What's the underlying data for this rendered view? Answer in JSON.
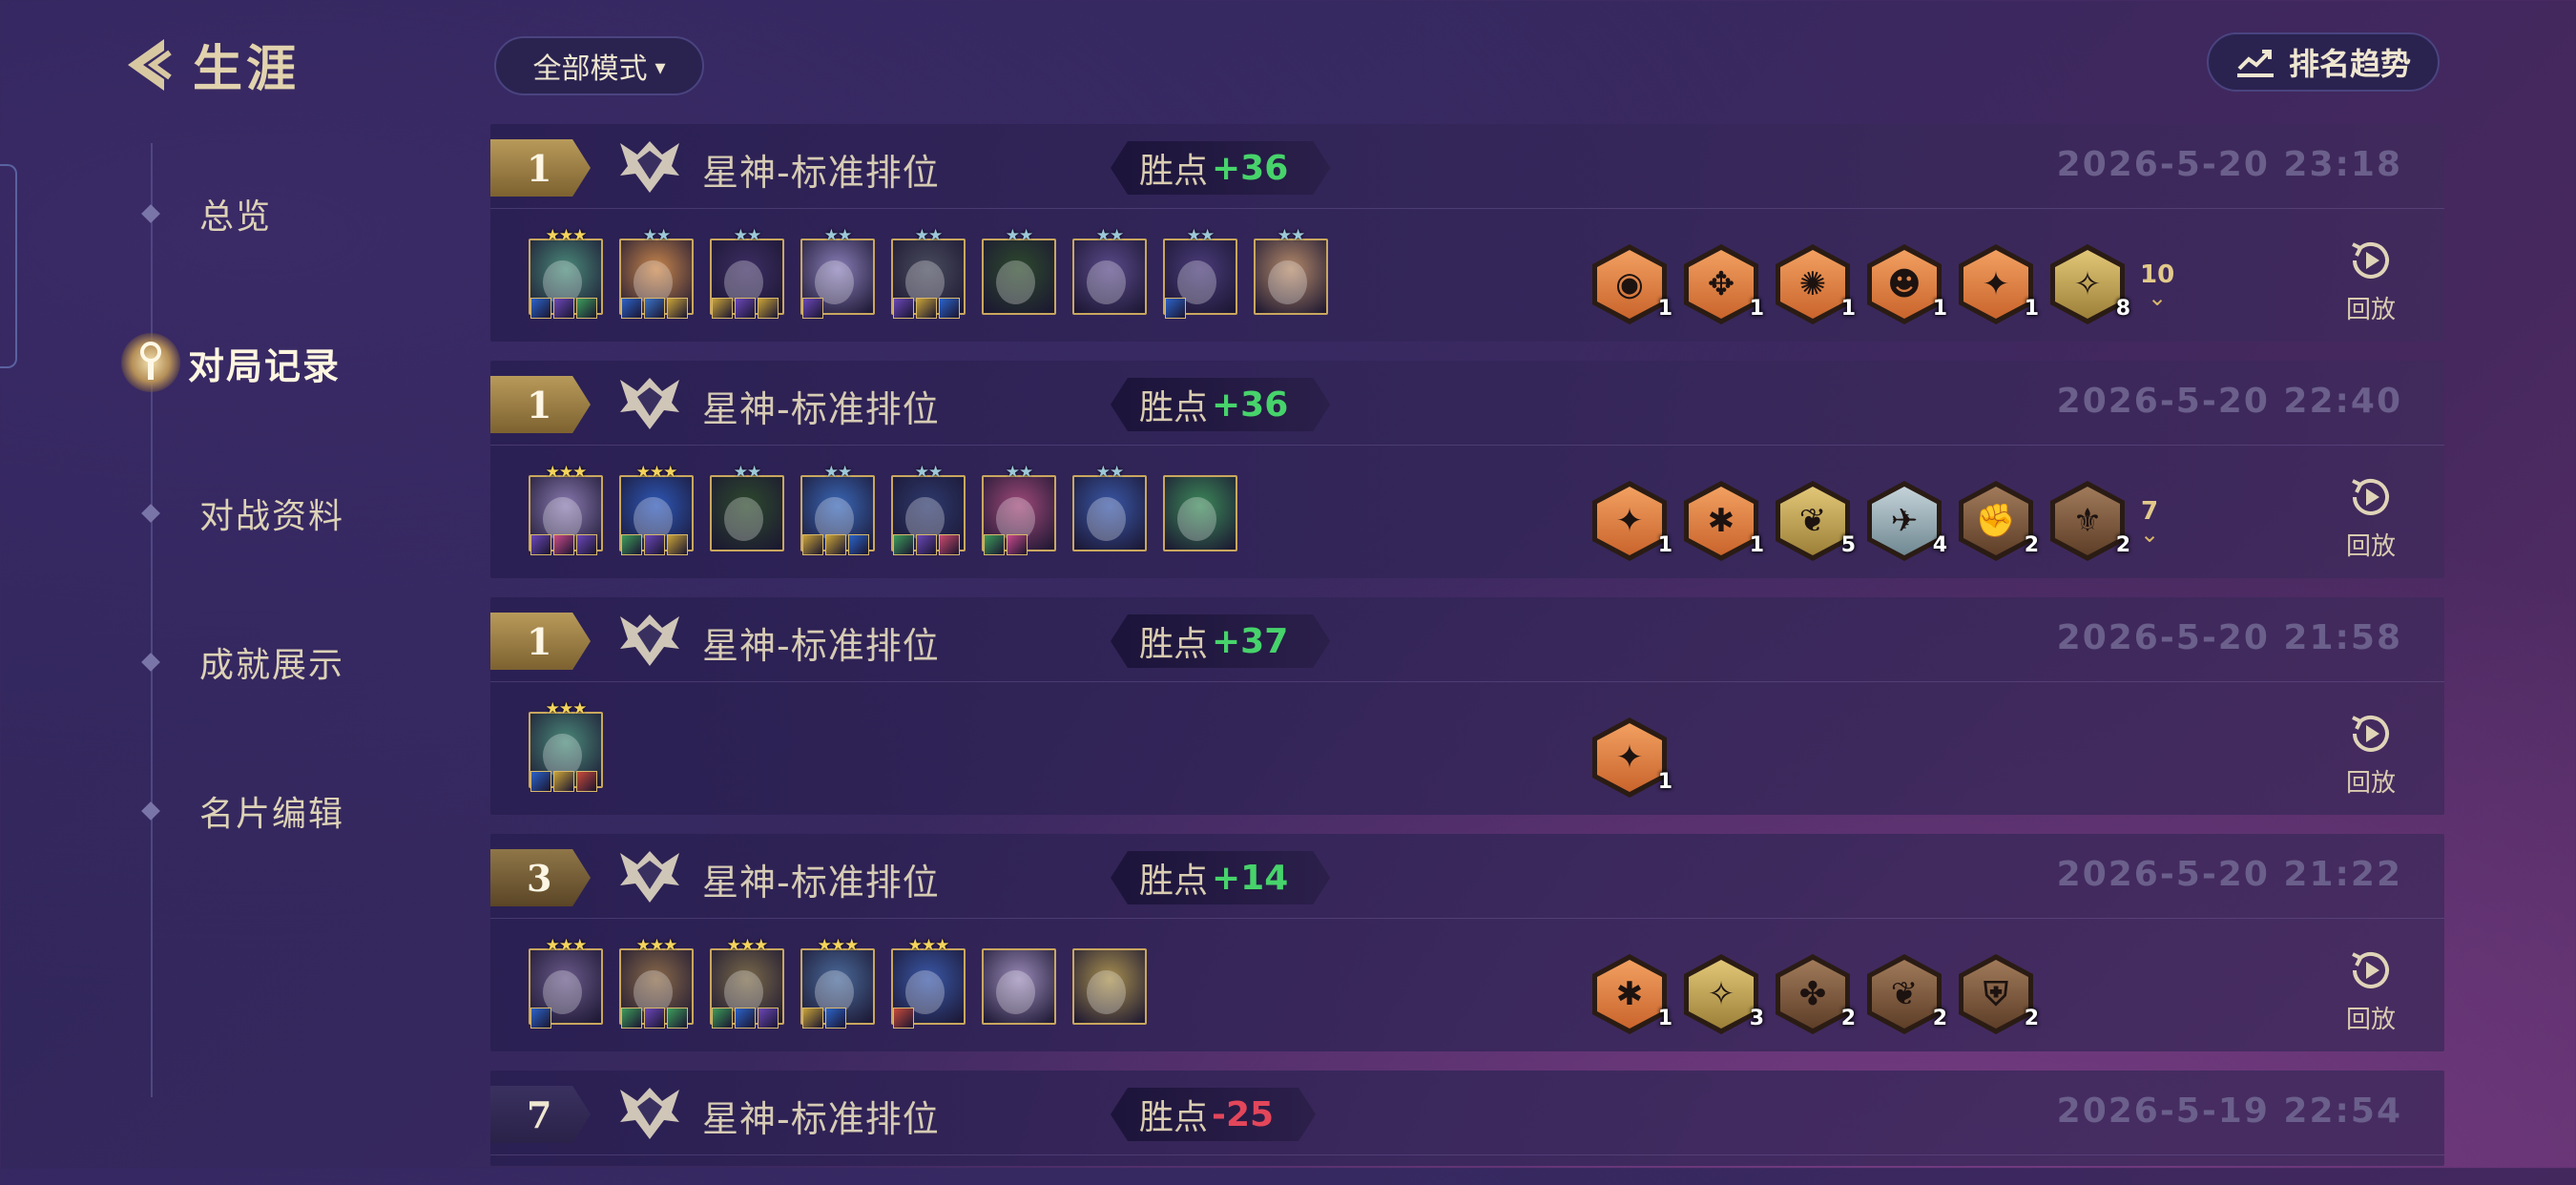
{
  "sidebar": {
    "title": "生涯",
    "items": [
      {
        "label": "总览",
        "active": false
      },
      {
        "label": "对局记录",
        "active": true
      },
      {
        "label": "对战资料",
        "active": false
      },
      {
        "label": "成就展示",
        "active": false
      },
      {
        "label": "名片编辑",
        "active": false
      }
    ]
  },
  "toolbar": {
    "mode_filter": "全部模式",
    "trend_button": "排名趋势"
  },
  "matches": [
    {
      "rank": "1",
      "mode": "星神-标准排位",
      "lp_label": "胜点",
      "lp_delta": "+36",
      "lp_sign": "plus",
      "date": "2026-5-20  23:18",
      "replay": "回放",
      "units": [
        {
          "stars": "★★★",
          "tier": "g3",
          "color": "#4b8a7a",
          "items": [
            "#2b63c9",
            "#6b47b8",
            "#3d9d5a"
          ]
        },
        {
          "stars": "★★",
          "tier": "s2",
          "color": "#c9874c",
          "items": [
            "#2b63c9",
            "#3a74c9",
            "#c9a338"
          ]
        },
        {
          "stars": "★★",
          "tier": "s2",
          "color": "#3d2e64",
          "items": [
            "#c9a338",
            "#6b47b8",
            "#c9a338"
          ]
        },
        {
          "stars": "★★",
          "tier": "s2",
          "color": "#8a7fb8",
          "items": [
            "#6b47b8"
          ]
        },
        {
          "stars": "★★",
          "tier": "s2",
          "color": "#4a4c5e",
          "items": [
            "#6b47b8",
            "#c9a338",
            "#2b63c9"
          ]
        },
        {
          "stars": "★★",
          "tier": "s2",
          "color": "#2e4a2e",
          "items": []
        },
        {
          "stars": "★★",
          "tier": "s2",
          "color": "#5a4a8a",
          "items": []
        },
        {
          "stars": "★★",
          "tier": "s2",
          "color": "#4a3c7a",
          "items": [
            "#2b63c9"
          ]
        },
        {
          "stars": "★★",
          "tier": "s2",
          "color": "#b48a6a",
          "items": []
        }
      ],
      "traits": [
        {
          "glyph": "◉",
          "count": "1",
          "style": "orange"
        },
        {
          "glyph": "✥",
          "count": "1",
          "style": "orange"
        },
        {
          "glyph": "✺",
          "count": "1",
          "style": "orange"
        },
        {
          "glyph": "☻",
          "count": "1",
          "style": "orange"
        },
        {
          "glyph": "✦",
          "count": "1",
          "style": "orange"
        },
        {
          "glyph": "✧",
          "count": "8",
          "style": "gold"
        }
      ],
      "more_count": "10"
    },
    {
      "rank": "1",
      "mode": "星神-标准排位",
      "lp_label": "胜点",
      "lp_delta": "+36",
      "lp_sign": "plus",
      "date": "2026-5-20  22:40",
      "replay": "回放",
      "units": [
        {
          "stars": "★★★",
          "tier": "g3",
          "color": "#8a7ab0",
          "items": [
            "#6b47b8",
            "#c94a8a",
            "#6b47b8"
          ]
        },
        {
          "stars": "★★★",
          "tier": "g3",
          "color": "#2e58b8",
          "items": [
            "#3d9d5a",
            "#6b47b8",
            "#c9a338"
          ]
        },
        {
          "stars": "★★",
          "tier": "s2",
          "color": "#2e4a2e",
          "items": []
        },
        {
          "stars": "★★",
          "tier": "s2",
          "color": "#3a68b8",
          "items": [
            "#c9a338",
            "#c9a338",
            "#2b63c9"
          ]
        },
        {
          "stars": "★★",
          "tier": "s2",
          "color": "#2e3a6e",
          "items": [
            "#3d9d5a",
            "#6b47b8",
            "#c94a6a"
          ]
        },
        {
          "stars": "★★",
          "tier": "s2",
          "color": "#a04a7a",
          "items": [
            "#3d9d5a",
            "#c94a8a"
          ]
        },
        {
          "stars": "★★",
          "tier": "s2",
          "color": "#3a58a8",
          "items": []
        },
        {
          "stars": "",
          "tier": "none",
          "color": "#3d8a5a",
          "items": []
        }
      ],
      "traits": [
        {
          "glyph": "✦",
          "count": "1",
          "style": "orange"
        },
        {
          "glyph": "✱",
          "count": "1",
          "style": "orange"
        },
        {
          "glyph": "❦",
          "count": "5",
          "style": "gold"
        },
        {
          "glyph": "✈",
          "count": "4",
          "style": "silver"
        },
        {
          "glyph": "✊",
          "count": "2",
          "style": "bronze"
        },
        {
          "glyph": "⚜",
          "count": "2",
          "style": "bronze"
        }
      ],
      "more_count": "7"
    },
    {
      "rank": "1",
      "mode": "星神-标准排位",
      "lp_label": "胜点",
      "lp_delta": "+37",
      "lp_sign": "plus",
      "date": "2026-5-20  21:58",
      "replay": "回放",
      "units": [
        {
          "stars": "★★★",
          "tier": "g3",
          "color": "#4b8a7a",
          "items": [
            "#2b63c9",
            "#c9a338",
            "#c94a3a"
          ]
        }
      ],
      "traits": [
        {
          "glyph": "✦",
          "count": "1",
          "style": "orange"
        }
      ],
      "more_count": ""
    },
    {
      "rank": "3",
      "mode": "星神-标准排位",
      "lp_label": "胜点",
      "lp_delta": "+14",
      "lp_sign": "plus",
      "date": "2026-5-20  21:22",
      "replay": "回放",
      "units": [
        {
          "stars": "★★★",
          "tier": "g3",
          "color": "#6a5a8a",
          "items": [
            "#2b63c9"
          ]
        },
        {
          "stars": "★★★",
          "tier": "g3",
          "color": "#8a6a4a",
          "items": [
            "#3d9d5a",
            "#6b47b8",
            "#3d9d5a"
          ]
        },
        {
          "stars": "★★★",
          "tier": "g3",
          "color": "#7a6a4a",
          "items": [
            "#3d9d5a",
            "#2b63c9",
            "#6b47b8"
          ]
        },
        {
          "stars": "★★★",
          "tier": "g3",
          "color": "#4a6a9a",
          "items": [
            "#c9a338",
            "#2b63c9"
          ]
        },
        {
          "stars": "★★★",
          "tier": "g3",
          "color": "#3a58a8",
          "items": [
            "#c94a3a"
          ]
        },
        {
          "stars": "",
          "tier": "none",
          "color": "#9a8ab8",
          "items": []
        },
        {
          "stars": "",
          "tier": "none",
          "color": "#a89050",
          "items": []
        }
      ],
      "traits": [
        {
          "glyph": "✱",
          "count": "1",
          "style": "orange"
        },
        {
          "glyph": "✧",
          "count": "3",
          "style": "gold"
        },
        {
          "glyph": "✤",
          "count": "2",
          "style": "bronze"
        },
        {
          "glyph": "❦",
          "count": "2",
          "style": "bronze"
        },
        {
          "glyph": "⛨",
          "count": "2",
          "style": "bronze"
        }
      ],
      "more_count": ""
    },
    {
      "rank": "7",
      "mode": "星神-标准排位",
      "lp_label": "胜点",
      "lp_delta": "-25",
      "lp_sign": "minus",
      "date": "2026-5-19  22:54",
      "replay": "",
      "units": [],
      "traits": [],
      "more_count": ""
    }
  ],
  "colors": {
    "accent_gold": "#c9a75e",
    "win_green": "#47d36b",
    "loss_red": "#e3465a",
    "trait_orange": "#e88a4a",
    "trait_gold": "#cdb25e",
    "trait_silver": "#9fb2bd",
    "trait_bronze": "#8a6446"
  },
  "icons": {
    "back": "back-arrow-icon",
    "active_nav": "key-icon",
    "trend": "trend-chart-icon",
    "mode_crest": "crest-icon",
    "replay": "replay-icon",
    "expand": "double-chevron-icon"
  }
}
